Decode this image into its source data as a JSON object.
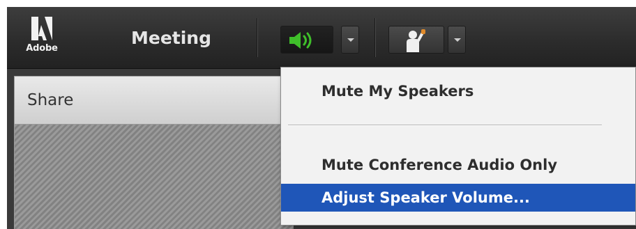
{
  "toolbar": {
    "logo_text": "Adobe",
    "meeting_label": "Meeting",
    "speaker_icon_color": "#3fbf2a"
  },
  "share_pod": {
    "title": "Share"
  },
  "speaker_menu": {
    "items": [
      {
        "label": "Mute My Speakers",
        "highlighted": false
      },
      {
        "label": "Mute Conference Audio Only",
        "highlighted": false
      },
      {
        "label": "Adjust Speaker Volume...",
        "highlighted": true
      }
    ],
    "highlight_color": "#1f56b8"
  }
}
